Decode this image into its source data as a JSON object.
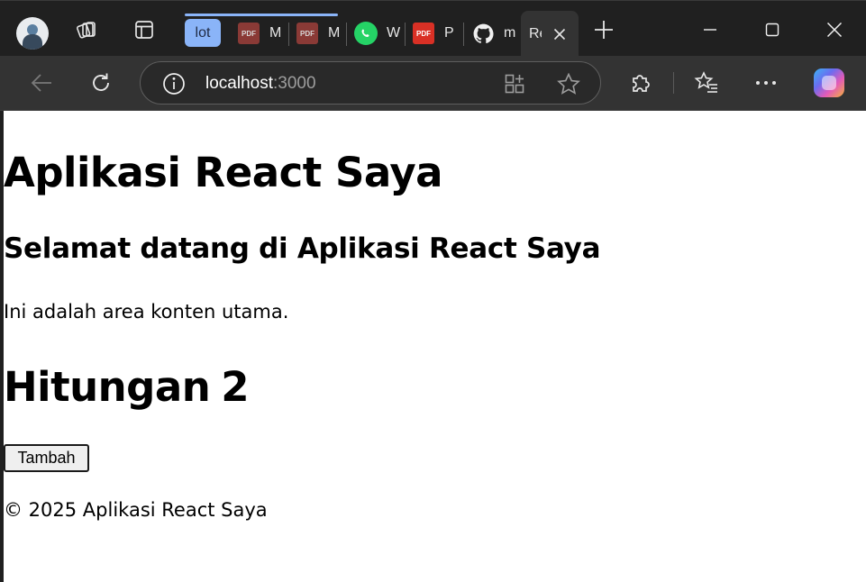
{
  "browser": {
    "tabs": [
      {
        "title": "lot",
        "favicon": "tab-group-chip"
      },
      {
        "title": "M",
        "favicon": "pdf-icon"
      },
      {
        "title": "M",
        "favicon": "pdf-icon"
      },
      {
        "title": "W",
        "favicon": "whatsapp-icon"
      },
      {
        "title": "P",
        "favicon": "pdf-icon"
      },
      {
        "title": "m",
        "favicon": "github-icon"
      }
    ],
    "active_tab": {
      "title": "Re"
    },
    "pdf_label": "PDF",
    "url": {
      "host": "localhost",
      "port": ":3000"
    },
    "group_color": "#8ab4f8"
  },
  "page": {
    "title": "Aplikasi React Saya",
    "welcome": "Selamat datang di Aplikasi React Saya",
    "intro": "Ini adalah area konten utama.",
    "count_label": "Hitungan",
    "count_value": "2",
    "add_button": "Tambah",
    "footer": "© 2025 Aplikasi React Saya"
  }
}
